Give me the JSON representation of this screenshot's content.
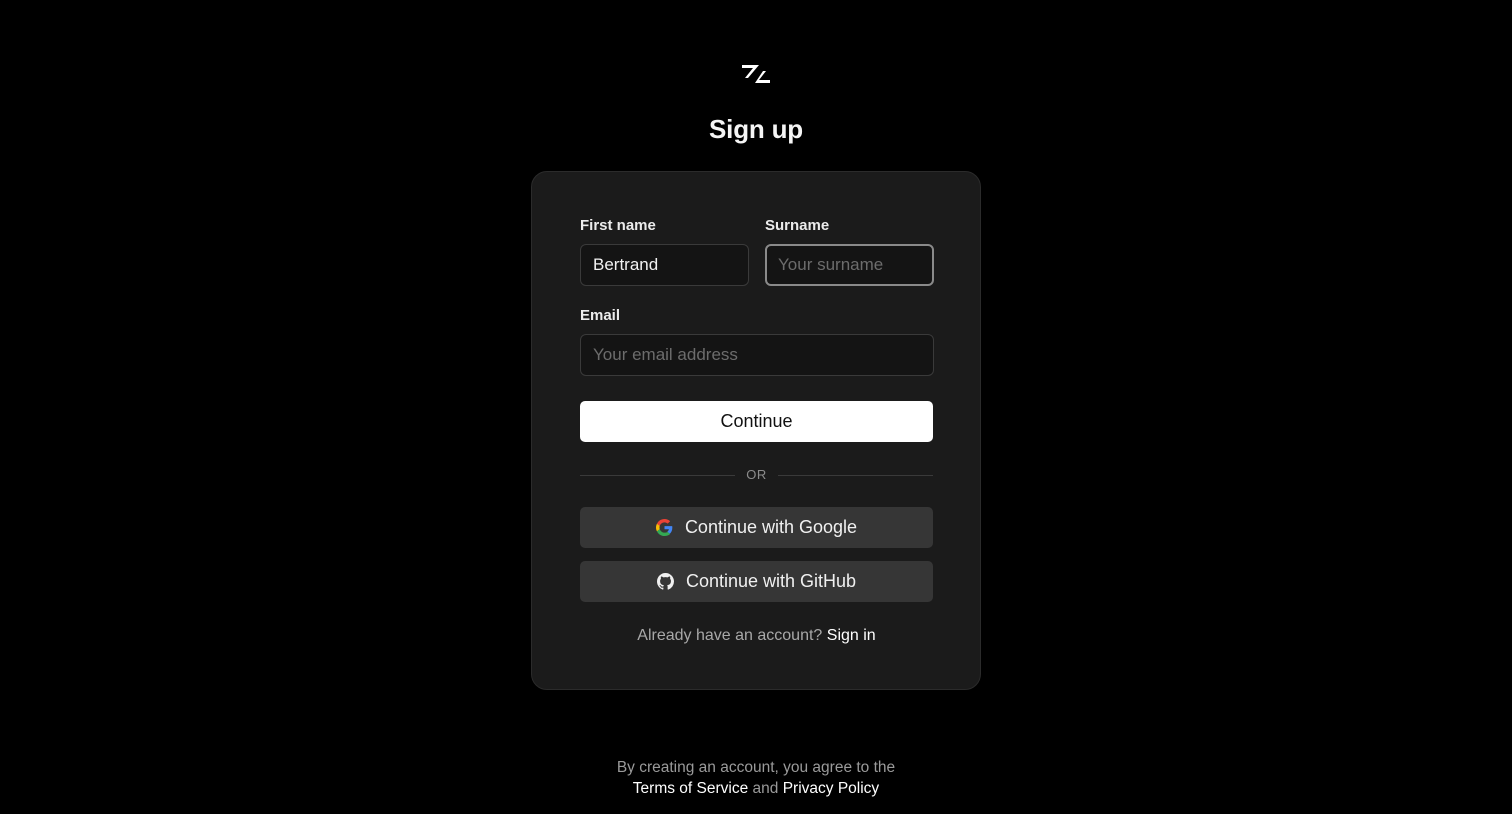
{
  "page": {
    "title": "Sign up",
    "logo_icon": "zed-logo-icon"
  },
  "form": {
    "first_name": {
      "label": "First name",
      "value": "Bertrand",
      "placeholder": ""
    },
    "surname": {
      "label": "Surname",
      "value": "",
      "placeholder": "Your surname",
      "focused": true
    },
    "email": {
      "label": "Email",
      "value": "",
      "placeholder": "Your email address"
    },
    "continue_label": "Continue",
    "divider_label": "OR",
    "google_label": "Continue with Google",
    "google_icon": "google-icon",
    "github_label": "Continue with GitHub",
    "github_icon": "github-icon",
    "signin_prompt": "Already have an account?",
    "signin_link": "Sign in"
  },
  "legal": {
    "line1": "By creating an account, you agree to the",
    "terms_link": "Terms of Service",
    "and_text": "and",
    "privacy_link": "Privacy Policy"
  },
  "colors": {
    "background": "#000000",
    "card": "#1b1b1b",
    "primary_button": "#ffffff",
    "social_button": "#363636"
  }
}
